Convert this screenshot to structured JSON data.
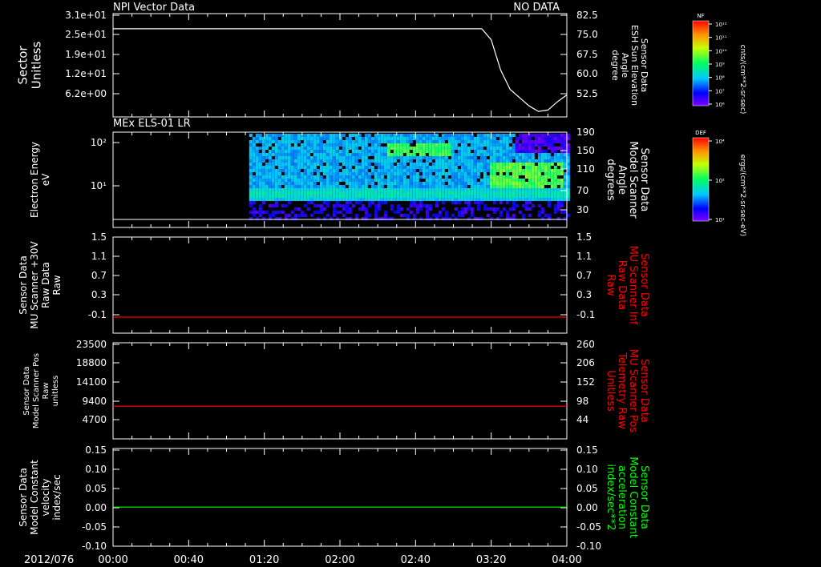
{
  "header": {
    "title": "NPI Vector Data",
    "status": "NO DATA",
    "panel2_title": "MEx ELS-01 LR"
  },
  "time_axis": {
    "date_label": "2012/076",
    "ticks": [
      "00:00",
      "00:40",
      "01:20",
      "02:00",
      "02:40",
      "03:20",
      "04:00"
    ],
    "start_min": 0,
    "end_min": 240
  },
  "colors": {
    "axes": "#ffffff",
    "red_trace": "#ff0000",
    "green_trace": "#00ff00",
    "red_label": "#ff0000",
    "green_label": "#00ff00"
  },
  "colorbars": [
    {
      "name": "NF",
      "unit_label": "cnts/(cm**2-sr-sec)",
      "tick_labels": [
        "10¹²",
        "10¹¹",
        "10¹⁰",
        "10⁹",
        "10⁸",
        "10⁷",
        "10⁶"
      ]
    },
    {
      "name": "DEF",
      "unit_label": "ergs/(cm**2-sr-sec-eV)",
      "tick_labels": [
        "10⁴",
        "10²",
        "10¹"
      ]
    }
  ],
  "chart_data": [
    {
      "type": "line",
      "left_ylabel": [
        "Sector",
        "Unitless"
      ],
      "left_ticks": [
        "3.1e+01",
        "2.5e+01",
        "1.9e+01",
        "1.2e+01",
        "6.2e+00"
      ],
      "right_ylabel": [
        "Sensor Data",
        "ESH Sun Elevation",
        "Angle",
        "degree"
      ],
      "right_ticks": [
        "82.5",
        "75.0",
        "67.5",
        "60.0",
        "52.5"
      ],
      "ylim_right": [
        45,
        82.5
      ],
      "series": [
        {
          "color": "#ffffff",
          "x_min": [
            0,
            195,
            200,
            205,
            210,
            215,
            220,
            225,
            230,
            235,
            240
          ],
          "y": [
            77.0,
            77.0,
            73.0,
            62.0,
            55.0,
            52.0,
            49.0,
            47.0,
            47.5,
            50.5,
            53.0
          ]
        }
      ]
    },
    {
      "type": "heatmap",
      "left_ylabel": [
        "Electron Energy",
        "eV"
      ],
      "left_ticks": [
        "10²",
        "10¹"
      ],
      "right_ylabel": [
        "Sensor Data",
        "Model Scanner",
        "Angle",
        "degrees"
      ],
      "right_ticks": [
        "190",
        "150",
        "110",
        "70",
        "30"
      ],
      "data_start_min": 72,
      "baseline_label": "",
      "colorscale": "DEF"
    },
    {
      "type": "line",
      "left_ylabel": [
        "Sensor Data",
        "MU Scanner +30V",
        "Raw Data",
        "Raw"
      ],
      "left_ticks": [
        "1.5",
        "1.1",
        "0.7",
        "0.3",
        "-0.1"
      ],
      "right_ylabel": [
        "Sensor Data",
        "MU Scanner Inf",
        "Raw Data",
        "Raw"
      ],
      "right_ticks": [
        "1.5",
        "1.1",
        "0.7",
        "0.3",
        "-0.1"
      ],
      "ylim": [
        -0.3,
        1.5
      ],
      "series": [
        {
          "color": "#ff0000",
          "x_min": [
            0,
            240
          ],
          "y": [
            0.0,
            0.0
          ]
        }
      ]
    },
    {
      "type": "line",
      "left_ylabel": [
        "Sensor Data",
        "Model Scanner Pos",
        "Raw",
        "unitless"
      ],
      "left_ticks": [
        "23500",
        "18800",
        "14100",
        "9400",
        "4700"
      ],
      "right_ylabel": [
        "Sensor Data",
        "MU Scanner Pos",
        "Telemetry Raw",
        "Unitless"
      ],
      "right_ticks": [
        "260",
        "206",
        "152",
        "98",
        "44"
      ],
      "ylim": [
        0,
        23500
      ],
      "series": [
        {
          "color": "#ff0000",
          "x_min": [
            0,
            240
          ],
          "y": [
            8000,
            8000
          ]
        }
      ]
    },
    {
      "type": "line",
      "left_ylabel": [
        "Sensor Data",
        "Model Constant",
        "velocity",
        "index/sec"
      ],
      "left_ticks": [
        "0.15",
        "0.10",
        "0.05",
        "0.00",
        "-0.05",
        "-0.10"
      ],
      "right_ylabel": [
        "Sensor Data",
        "Model Constant",
        "acceleration",
        "index/sec**2"
      ],
      "right_ticks": [
        "0.15",
        "0.10",
        "0.05",
        "0.00",
        "-0.05",
        "-0.10"
      ],
      "ylim": [
        -0.1,
        0.15
      ],
      "series": [
        {
          "color": "#00ff00",
          "x_min": [
            0,
            240
          ],
          "y": [
            0.0,
            0.0
          ]
        }
      ]
    }
  ]
}
